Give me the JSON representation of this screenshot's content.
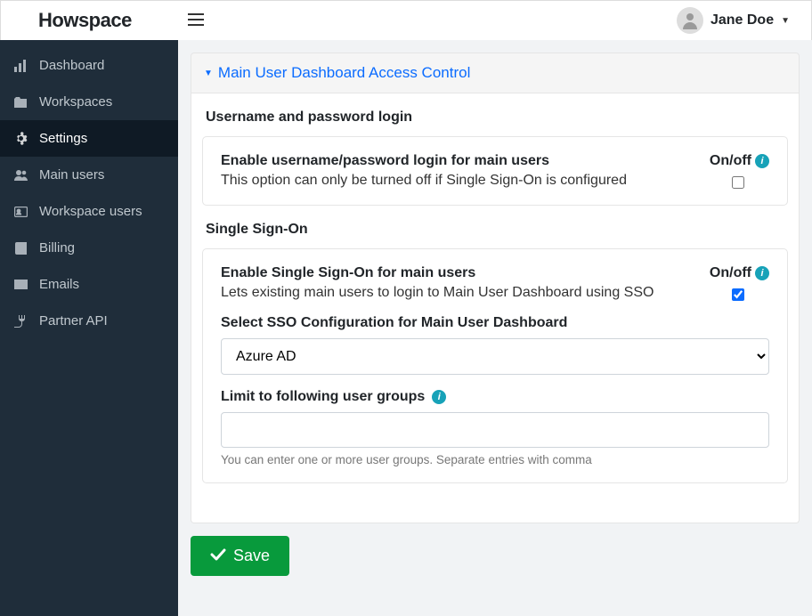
{
  "brand": "Howspace",
  "user": {
    "name": "Jane Doe"
  },
  "sidebar": {
    "items": [
      {
        "label": "Dashboard",
        "icon": "chart"
      },
      {
        "label": "Workspaces",
        "icon": "folder"
      },
      {
        "label": "Settings",
        "icon": "gear",
        "active": true
      },
      {
        "label": "Main users",
        "icon": "users"
      },
      {
        "label": "Workspace users",
        "icon": "id"
      },
      {
        "label": "Billing",
        "icon": "book"
      },
      {
        "label": "Emails",
        "icon": "mail"
      },
      {
        "label": "Partner API",
        "icon": "plug"
      }
    ]
  },
  "section": {
    "title": "Main User Dashboard Access Control",
    "onoff_label": "On/off",
    "username_heading": "Username and password login",
    "enable_userpass": {
      "title": "Enable username/password login for main users",
      "help": "This option can only be turned off if Single Sign-On is configured",
      "checked": false
    },
    "sso_heading": "Single Sign-On",
    "enable_sso": {
      "title": "Enable Single Sign-On for main users",
      "help": "Lets existing main users to login to Main User Dashboard using SSO",
      "checked": true
    },
    "sso_config": {
      "label": "Select SSO Configuration for Main User Dashboard",
      "value": "Azure AD"
    },
    "limit_groups": {
      "label": "Limit to following user groups",
      "value": "",
      "hint": "You can enter one or more user groups. Separate entries with comma"
    },
    "save_label": "Save"
  }
}
